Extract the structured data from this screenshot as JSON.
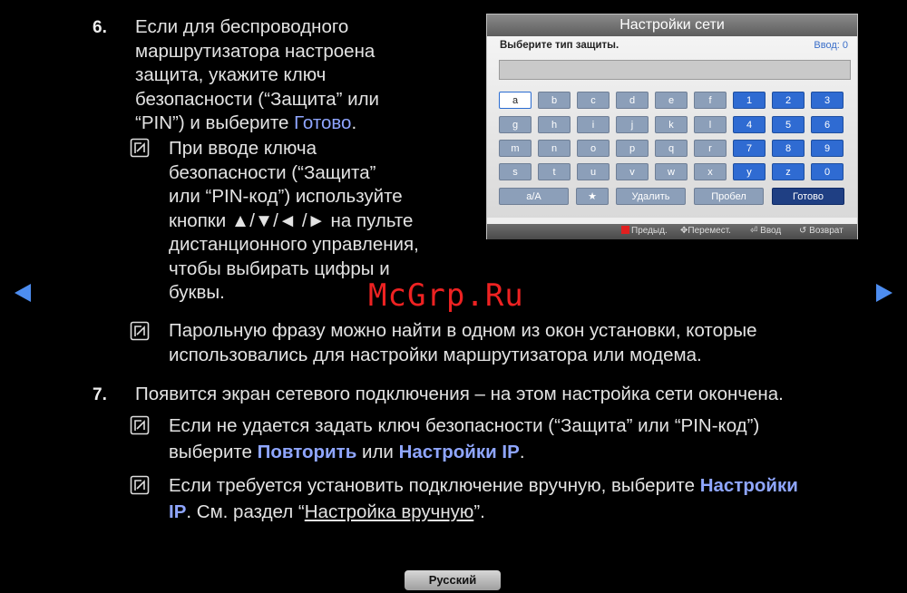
{
  "step6": {
    "number": "6.",
    "lines": [
      "Если для беспроводного",
      "маршрутизатора настроена",
      "защита, укажите ключ",
      "безопасности (“Защита” или"
    ],
    "last_prefix": "“PIN”) и выберите ",
    "last_link": "Готово",
    "last_suffix": ".",
    "note1_lines": [
      "При вводе ключа",
      "безопасности (“Защита”",
      "или “PIN-код”) используйте",
      "кнопки ▲/▼/◄ /► на пульте",
      "дистанционного управления,",
      "чтобы выбирать цифры и",
      "буквы."
    ],
    "note2_lines": [
      "Парольную фразу можно найти в одном из окон установки, которые",
      "использовались для настройки маршрутизатора или модема."
    ]
  },
  "step7": {
    "number": "7.",
    "text": "Появится экран сетевого подключения – на этом настройка сети окончена.",
    "note1_line1": "Если не удается задать ключ безопасности (“Защита” или “PIN-код”)",
    "note1_pre": "выберите ",
    "note1_link1": "Повторить",
    "note1_mid": " или ",
    "note1_link2": "Настройки IP",
    "note1_end": ".",
    "note2_pre": "Если требуется установить подключение вручную, выберите ",
    "note2_link_a": "Настройки",
    "note2_link_b": "IP",
    "note2_mid": ". См. раздел “",
    "note2_ref": "Настройка вручную",
    "note2_end": "”."
  },
  "dialog": {
    "title": "Настройки сети",
    "prompt": "Выберите тип защиты.",
    "input_count": "Ввод: 0",
    "input_value": "",
    "rows": [
      [
        "a",
        "b",
        "c",
        "d",
        "e",
        "f",
        "1",
        "2",
        "3"
      ],
      [
        "g",
        "h",
        "i",
        "j",
        "k",
        "l",
        "4",
        "5",
        "6"
      ],
      [
        "m",
        "n",
        "o",
        "p",
        "q",
        "r",
        "7",
        "8",
        "9"
      ],
      [
        "s",
        "t",
        "u",
        "v",
        "w",
        "x",
        "y",
        "z",
        "0"
      ]
    ],
    "selected_key": "a",
    "bottom": {
      "shift": "a/A",
      "star": "★",
      "delete": "Удалить",
      "space": "Пробел",
      "done": "Готово"
    },
    "footer": {
      "prev": "Предыд.",
      "move": "Перемест.",
      "enter": "Ввод",
      "back": "Возврат"
    }
  },
  "nav": {
    "prev_icon": "left-arrow-icon",
    "next_icon": "right-arrow-icon",
    "color": "#4d8df0"
  },
  "watermark": "McGrp.Ru",
  "language_button": "Русский",
  "colors": {
    "link": "#8fa6ff",
    "background": "#000000",
    "text": "#e3e3e3"
  }
}
